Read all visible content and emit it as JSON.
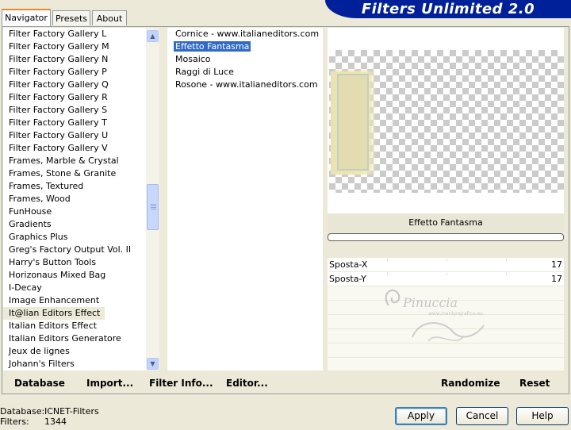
{
  "tabs": [
    {
      "label": "Navigator",
      "active": true
    },
    {
      "label": "Presets",
      "active": false
    },
    {
      "label": "About",
      "active": false
    }
  ],
  "banner": {
    "title": "Filters Unlimited 2.0"
  },
  "categories": [
    "Filter Factory Gallery L",
    "Filter Factory Gallery M",
    "Filter Factory Gallery N",
    "Filter Factory Gallery P",
    "Filter Factory Gallery Q",
    "Filter Factory Gallery R",
    "Filter Factory Gallery S",
    "Filter Factory Gallery T",
    "Filter Factory Gallery U",
    "Filter Factory Gallery V",
    "Frames, Marble & Crystal",
    "Frames, Stone & Granite",
    "Frames, Textured",
    "Frames, Wood",
    "FunHouse",
    "Gradients",
    "Graphics Plus",
    "Greg's Factory Output Vol. II",
    "Harry's Button Tools",
    "Horizonaus Mixed Bag",
    "I-Decay",
    "Image Enhancement",
    "It@lian Editors Effect",
    "Italian Editors Effect",
    "Italian Editors Generatore",
    "Jeux de lignes",
    "Johann's Filters"
  ],
  "selected_category": "It@lian Editors Effect",
  "filters": [
    "Cornice - www.italianeditors.com",
    "Effetto Fantasma",
    "Mosaico",
    "Raggi di Luce",
    "Rosone - www.italianeditors.com"
  ],
  "selected_filter": "Effetto Fantasma",
  "preview_label": "Effetto Fantasma",
  "params": [
    {
      "name": "Sposta-X",
      "value": "17"
    },
    {
      "name": "Sposta-Y",
      "value": "17"
    }
  ],
  "watermark": {
    "name": "Pinuccia",
    "site": "www.marilyngrafica.eu"
  },
  "commands": {
    "database": "Database",
    "import": "Import...",
    "filter_info": "Filter Info...",
    "editor": "Editor...",
    "randomize": "Randomize",
    "reset": "Reset"
  },
  "status": {
    "database_label": "Database:",
    "database_value": "ICNET-Filters",
    "filters_label": "Filters:",
    "filters_value": "1344"
  },
  "buttons": {
    "apply": "Apply",
    "cancel": "Cancel",
    "help": "Help"
  },
  "colors": {
    "banner": "#00209a",
    "selection": "#316ac5",
    "tab_accent": "#e68b2c"
  }
}
